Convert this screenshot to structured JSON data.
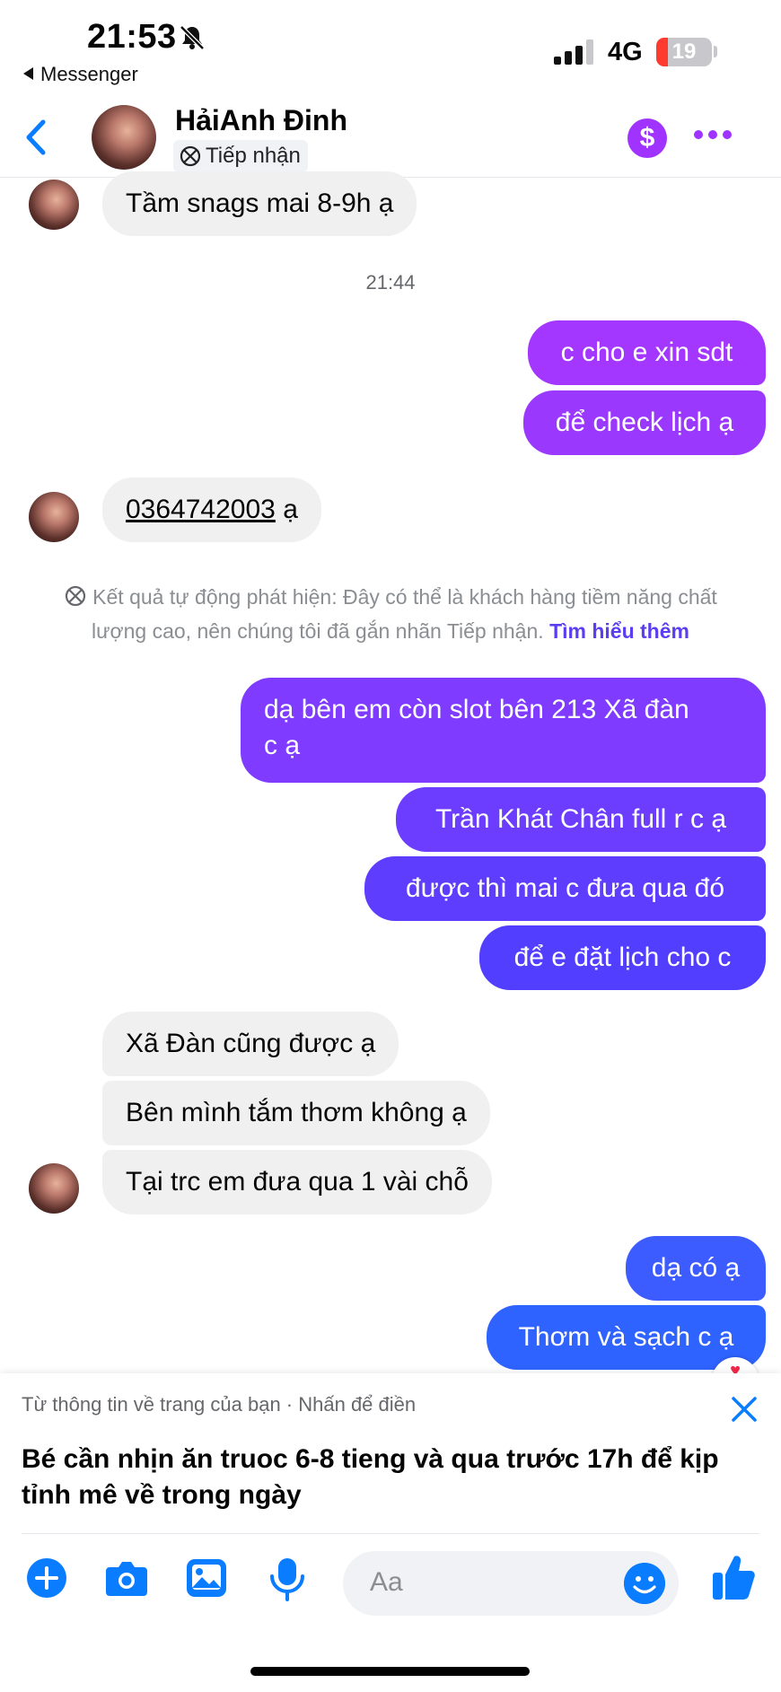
{
  "status_bar": {
    "time": "21:53",
    "back_app": "Messenger",
    "network": "4G",
    "battery": "19"
  },
  "header": {
    "name": "HảiAnh Đinh",
    "tag": "Tiếp nhận"
  },
  "messages": [
    {
      "side": "in",
      "text": "Tầm snags mai 8-9h ạ"
    },
    {
      "side": "out",
      "text": "c cho e xin sdt"
    },
    {
      "side": "out",
      "text": "để check lịch ạ"
    },
    {
      "side": "in",
      "phone": "0364742003",
      "suffix": " ạ"
    },
    {
      "side": "out",
      "text": "dạ bên em còn slot bên 213 Xã đàn",
      "text2": "c ạ"
    },
    {
      "side": "out",
      "text": "Trần Khát Chân full r c ạ"
    },
    {
      "side": "out",
      "text": "được thì mai c đưa qua đó"
    },
    {
      "side": "out",
      "text": "để e đặt lịch cho c"
    },
    {
      "side": "in",
      "text": "Xã Đàn cũng được ạ"
    },
    {
      "side": "in",
      "text": "Bên mình tắm thơm không ạ"
    },
    {
      "side": "in",
      "text": "Tại trc em đưa qua 1 vài chỗ"
    },
    {
      "side": "out",
      "text": "dạ có ạ"
    },
    {
      "side": "out",
      "text": "Thơm và sạch c ạ"
    }
  ],
  "timestamp": "21:44",
  "notice": {
    "text": "Kết quả tự động phát hiện: Đây có thể là khách hàng tiềm năng chất lượng cao, nên chúng tôi đã gắn nhãn Tiếp nhận.",
    "link": "Tìm hiểu thêm"
  },
  "suggestion": {
    "hint": "Từ thông tin về trang của bạn · Nhấn để điền",
    "text": "Bé cần nhịn ăn truoc 6-8 tieng và qua trước 17h để kịp tỉnh mê về trong ngày"
  },
  "composer": {
    "placeholder": "Aa"
  },
  "colors": {
    "accent": "#0a7cff",
    "purple": "#a033ff",
    "incoming_bubble": "#f0f0f0",
    "gradient_top": "#a033ff",
    "gradient_bottom": "#1f6bff"
  }
}
